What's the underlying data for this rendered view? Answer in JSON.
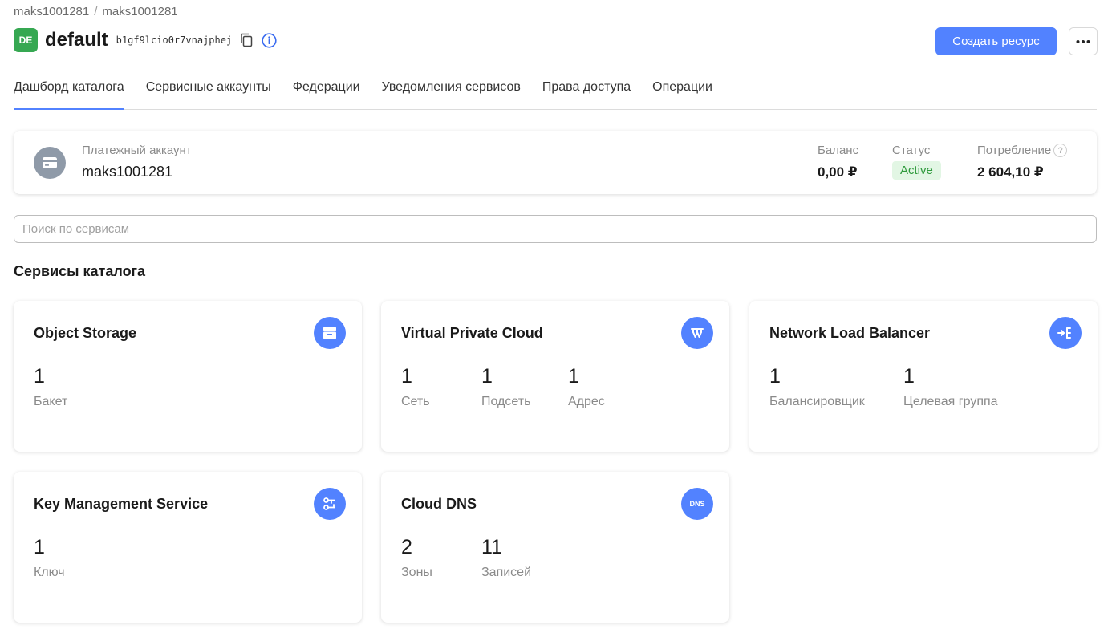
{
  "breadcrumb": {
    "items": [
      "maks1001281",
      "maks1001281"
    ],
    "separator": "/"
  },
  "header": {
    "badge": "DE",
    "title": "default",
    "folder_id": "b1gf9lcio0r7vnajphej",
    "create_button": "Создать ресурс"
  },
  "tabs": [
    {
      "label": "Дашборд каталога",
      "active": true
    },
    {
      "label": "Сервисные аккаунты",
      "active": false
    },
    {
      "label": "Федерации",
      "active": false
    },
    {
      "label": "Уведомления сервисов",
      "active": false
    },
    {
      "label": "Права доступа",
      "active": false
    },
    {
      "label": "Операции",
      "active": false
    }
  ],
  "billing": {
    "label": "Платежный аккаунт",
    "name": "maks1001281",
    "balance_label": "Баланс",
    "balance_value": "0,00 ₽",
    "status_label": "Статус",
    "status_value": "Active",
    "consumption_label": "Потребление",
    "consumption_value": "2 604,10 ₽",
    "help_glyph": "?"
  },
  "search": {
    "placeholder": "Поиск по сервисам",
    "value": ""
  },
  "section_title": "Сервисы каталога",
  "services": [
    {
      "title": "Object Storage",
      "icon": "storage-icon",
      "stats": [
        {
          "value": "1",
          "label": "Бакет"
        }
      ]
    },
    {
      "title": "Virtual Private Cloud",
      "icon": "network-icon",
      "stats": [
        {
          "value": "1",
          "label": "Сеть"
        },
        {
          "value": "1",
          "label": "Подсеть"
        },
        {
          "value": "1",
          "label": "Адрес"
        }
      ]
    },
    {
      "title": "Network Load Balancer",
      "icon": "balancer-icon",
      "stats": [
        {
          "value": "1",
          "label": "Балансировщик"
        },
        {
          "value": "1",
          "label": "Целевая группа"
        }
      ]
    },
    {
      "title": "Key Management Service",
      "icon": "key-icon",
      "stats": [
        {
          "value": "1",
          "label": "Ключ"
        }
      ]
    },
    {
      "title": "Cloud DNS",
      "icon": "dns-icon",
      "icon_text": "DNS",
      "stats": [
        {
          "value": "2",
          "label": "Зоны"
        },
        {
          "value": "11",
          "label": "Записей"
        }
      ]
    }
  ],
  "colors": {
    "accent": "#5282ff",
    "badge_green": "#36a852",
    "status_bg": "#e2f6e4",
    "status_text": "#2f9a3c"
  }
}
